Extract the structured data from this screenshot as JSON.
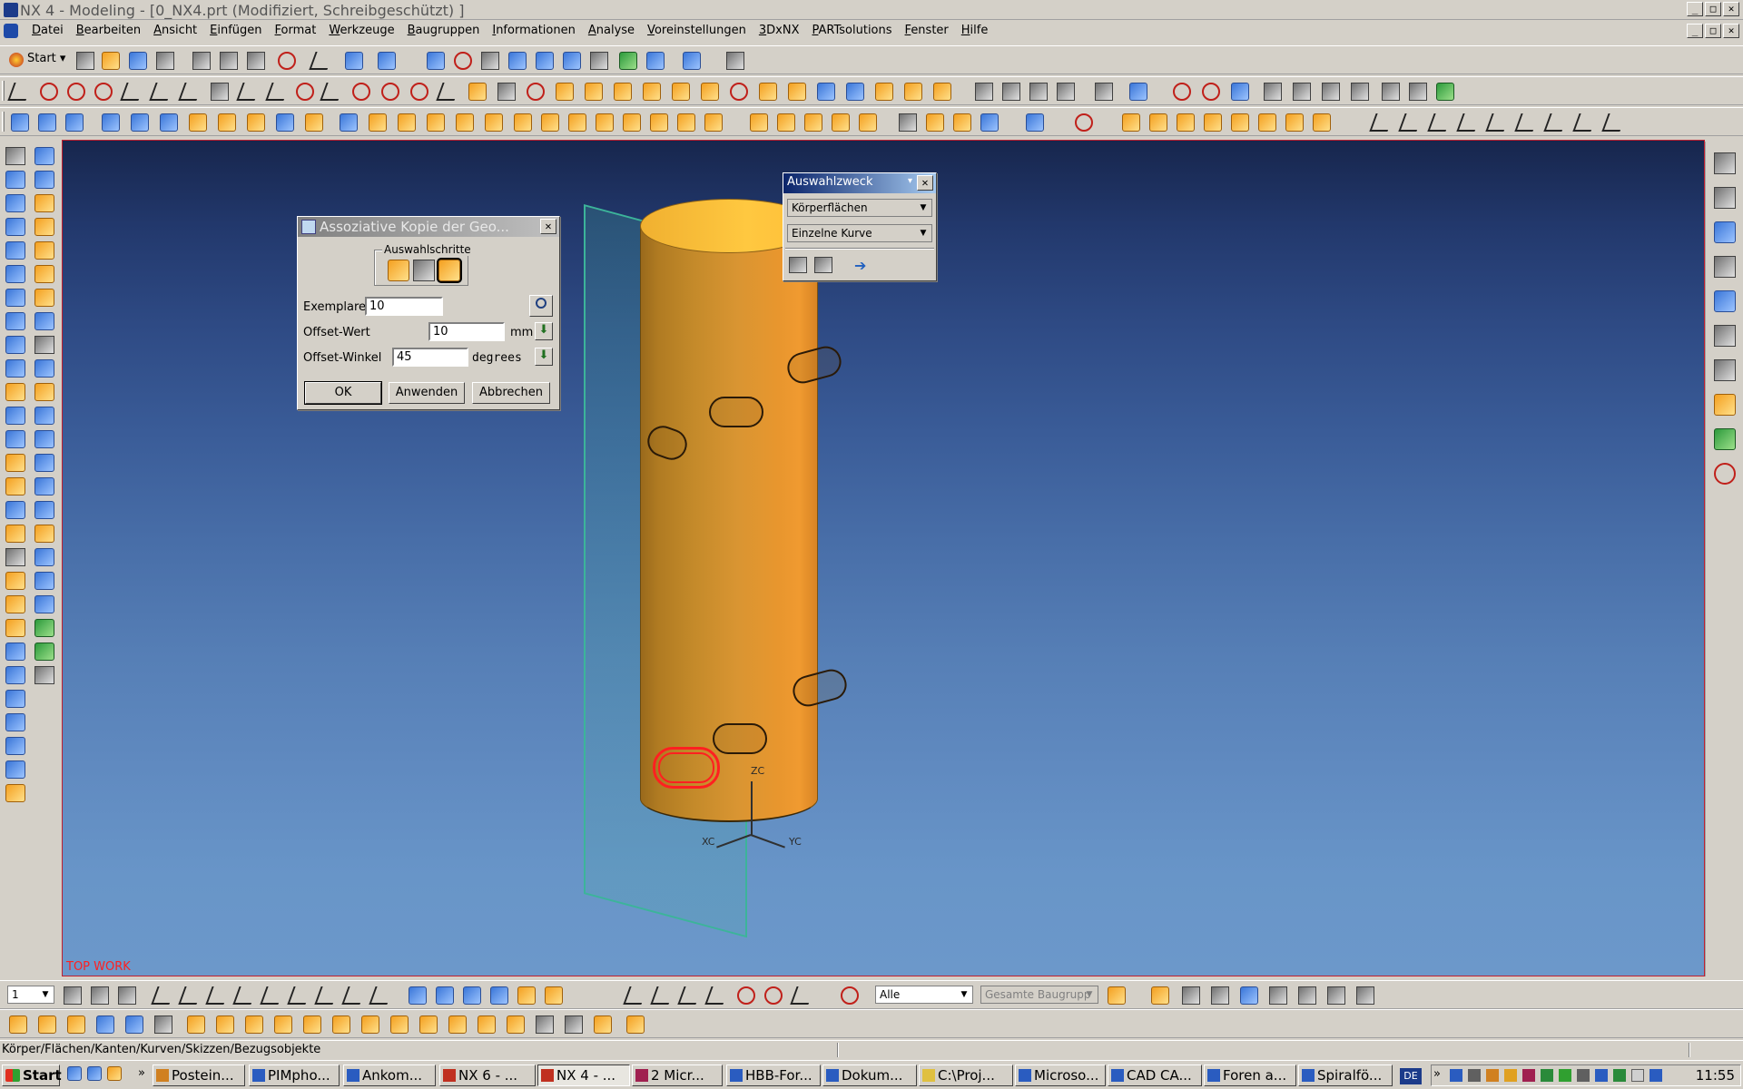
{
  "window": {
    "title": "NX 4 - Modeling - [0_NX4.prt (Modifiziert, Schreibgeschützt) ]"
  },
  "menu": [
    "Datei",
    "Bearbeiten",
    "Ansicht",
    "Einfügen",
    "Format",
    "Werkzeuge",
    "Baugruppen",
    "Informationen",
    "Analyse",
    "Voreinstellungen",
    "3DxNX",
    "PARTsolutions",
    "Fenster",
    "Hilfe"
  ],
  "toolbar": {
    "start_label": "Start"
  },
  "viewport": {
    "corner_label": "TOP WORK",
    "axis": {
      "z": "ZC",
      "y": "YC",
      "x": "XC"
    }
  },
  "dialog_copy": {
    "title": "Assoziative Kopie der Geo...",
    "group_label": "Auswahlschritte",
    "exemplare_label": "Exemplare",
    "exemplare_value": "10",
    "offset_wert_label": "Offset-Wert",
    "offset_wert_value": "10",
    "offset_wert_unit": "mm",
    "offset_winkel_label": "Offset-Winkel",
    "offset_winkel_value": "45",
    "offset_winkel_unit": "degrees",
    "ok_label": "OK",
    "apply_label": "Anwenden",
    "cancel_label": "Abbrechen"
  },
  "dialog_select": {
    "title": "Auswahlzweck",
    "option1": "Körperflächen",
    "option2": "Einzelne Kurve"
  },
  "bottom_toolbar": {
    "layer_value": "1",
    "filter_value": "Alle",
    "scope_value": "Gesamte Baugrupp"
  },
  "status": {
    "text": "Körper/Flächen/Kanten/Kurven/Skizzen/Bezugsobjekte"
  },
  "taskbar": {
    "start_label": "Start",
    "tasks": [
      "Postein...",
      "PIMpho...",
      "Ankom...",
      "NX 6 - ...",
      "NX 4 - ...",
      "2 Micr...",
      "HBB-For...",
      "Dokum...",
      "C:\\Proj...",
      "Microso...",
      "CAD CA...",
      "Foren a...",
      "Spiralfö..."
    ],
    "lang": "DE",
    "clock": "11:55"
  }
}
